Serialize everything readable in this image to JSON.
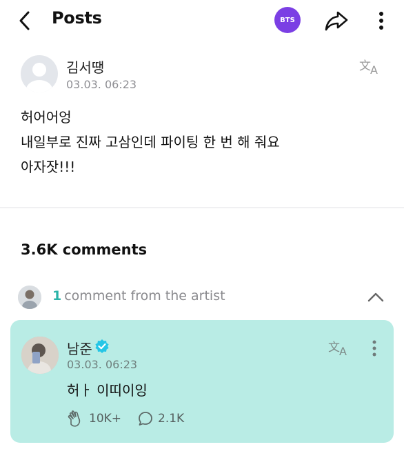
{
  "header": {
    "title": "Posts",
    "community_badge": "BTS",
    "back_icon": "chevron-left-icon",
    "share_icon": "share-arrow-icon",
    "more_icon": "vertical-dots-icon",
    "badge_color": "#7b3fe4"
  },
  "post": {
    "author": "김서땡",
    "time": "03.03. 06:23",
    "lines": [
      "허어어엉",
      "내일부로 진짜 고삼인데 파이팅 한 번 해 줘요",
      "아자잣!!!"
    ],
    "translate_icon": "translate-icon"
  },
  "comments": {
    "count_label": "3.6K comments"
  },
  "artist_section": {
    "count": "1",
    "label": "comment from the artist",
    "accent": "#2bb3a8"
  },
  "artist_comment": {
    "name": "남준",
    "time": "03.03. 06:23",
    "text": "허ㅏ 이띠이잉",
    "likes": "10K+",
    "replies": "2.1K",
    "background": "#b9ece5"
  }
}
